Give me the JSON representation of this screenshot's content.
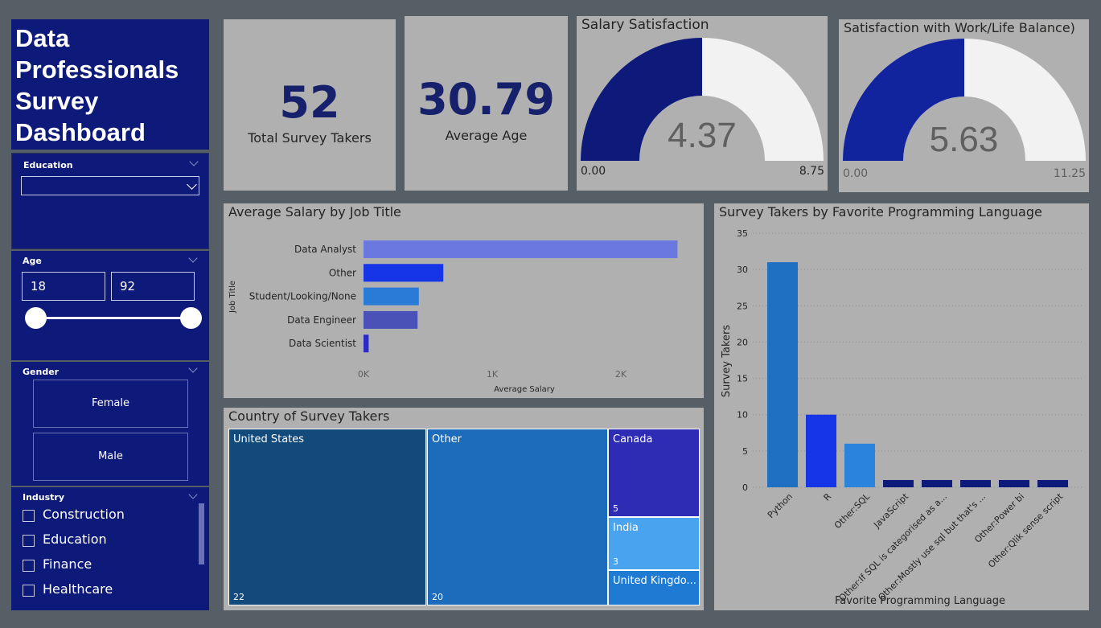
{
  "title": {
    "line1": "Data",
    "line2": "Professionals",
    "line3": "Survey",
    "line4": "Dashboard"
  },
  "slicers": {
    "education": {
      "label": "Education",
      "value": ""
    },
    "age": {
      "label": "Age",
      "min": "18",
      "max": "92"
    },
    "gender": {
      "label": "Gender",
      "options": [
        "Female",
        "Male"
      ]
    },
    "industry": {
      "label": "Industry",
      "options": [
        "Construction",
        "Education",
        "Finance",
        "Healthcare"
      ]
    }
  },
  "cards": {
    "survey_takers": {
      "value": "52",
      "label": "Total Survey Takers"
    },
    "average_age": {
      "value": "30.79",
      "label": "Average Age"
    }
  },
  "gauges": {
    "salary": {
      "title": "Salary Satisfaction",
      "value": "4.37",
      "min_label": "0.00",
      "max_label": "8.75",
      "fill_fraction": 0.5,
      "fill_color": "#0e1a7a"
    },
    "worklife": {
      "title": "Satisfaction with Work/Life Balance)",
      "value": "5.63",
      "min_label": "0.00",
      "max_label": "11.25",
      "fill_fraction": 0.5,
      "fill_color": "#12239e"
    }
  },
  "colors": {
    "navy": "#0e1a7a",
    "panel": "#b0b0b0",
    "background": "#565e66"
  },
  "chart_data": [
    {
      "type": "bar",
      "orientation": "horizontal",
      "title": "Average Salary by Job Title",
      "xlabel": "Average Salary",
      "ylabel": "Job Title",
      "categories": [
        "Data Analyst",
        "Other",
        "Student/Looking/None",
        "Data Engineer",
        "Data Scientist"
      ],
      "values": [
        2440,
        620,
        430,
        420,
        40
      ],
      "colors": [
        "#6b78e0",
        "#1535e6",
        "#2a7ad8",
        "#4a52b8",
        "#2b2bc8"
      ],
      "xticks": [
        "0K",
        "1K",
        "2K"
      ],
      "xlim": [
        0,
        2600
      ],
      "grid": false,
      "legend": "none"
    },
    {
      "type": "bar",
      "title": "Survey Takers by Favorite Programming Language",
      "xlabel": "Favorite Programming Language",
      "ylabel": "Survey Takers",
      "categories": [
        "Python",
        "R",
        "Other:SQL",
        "JavaScript",
        "Other:If SQL is categorised as a...",
        "Other:Mostly use sql but that's ...",
        "Other:Power bi",
        "Other:Qlik sense script"
      ],
      "values": [
        31,
        10,
        6,
        1,
        1,
        1,
        1,
        1
      ],
      "colors": [
        "#1f6fc2",
        "#1535e6",
        "#2a83dc",
        "#0e1a7a",
        "#0e1a7a",
        "#0e1a7a",
        "#0e1a7a",
        "#0e1a7a"
      ],
      "yticks": [
        "0",
        "5",
        "10",
        "15",
        "20",
        "25",
        "30",
        "35"
      ],
      "ylim": [
        0,
        35
      ],
      "grid": true,
      "legend": "none"
    },
    {
      "type": "treemap",
      "title": "Country of Survey Takers",
      "labels": [
        "United States",
        "Other",
        "Canada",
        "India",
        "United Kingdo..."
      ],
      "values": [
        22,
        20,
        5,
        3,
        2
      ],
      "value_labels": [
        "22",
        "20",
        "5",
        "3",
        ""
      ],
      "colors": [
        "#134a7c",
        "#1d6cbc",
        "#2e2bb4",
        "#4aa3ee",
        "#1e7ad2"
      ]
    }
  ]
}
